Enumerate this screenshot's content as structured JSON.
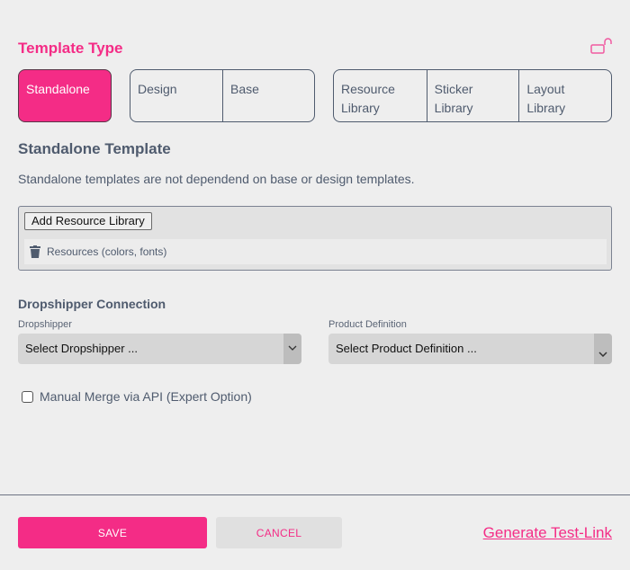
{
  "header": {
    "title": "Template Type",
    "lock_icon": "unlock-icon"
  },
  "template_types": {
    "standalone": {
      "label": "Standalone",
      "selected": true
    },
    "design_base": [
      {
        "label": "Design",
        "selected": false
      },
      {
        "label": "Base",
        "selected": false
      }
    ],
    "libraries": [
      {
        "label": "Resource Library",
        "selected": false
      },
      {
        "label": "Sticker Library",
        "selected": false
      },
      {
        "label": "Layout Library",
        "selected": false
      }
    ]
  },
  "standalone_section": {
    "title": "Standalone Template",
    "description": "Standalone templates are not dependend on base or design templates."
  },
  "resources": {
    "add_button_label": "Add Resource Library",
    "items": [
      {
        "label": "Resources (colors, fonts)",
        "icon": "trash-icon"
      }
    ]
  },
  "dropshipper": {
    "title": "Dropshipper Connection",
    "dropshipper_label": "Dropshipper",
    "dropshipper_value": "Select Dropshipper ...",
    "product_label": "Product Definition",
    "product_value": "Select Product Definition ..."
  },
  "manual_merge": {
    "label": "Manual Merge via API (Expert Option)",
    "checked": false
  },
  "footer": {
    "save_label": "SAVE",
    "cancel_label": "CANCEL",
    "test_link_label": "Generate Test-Link"
  },
  "colors": {
    "accent": "#f42c86",
    "text": "#4f5b6e",
    "background": "#eeeeee"
  }
}
